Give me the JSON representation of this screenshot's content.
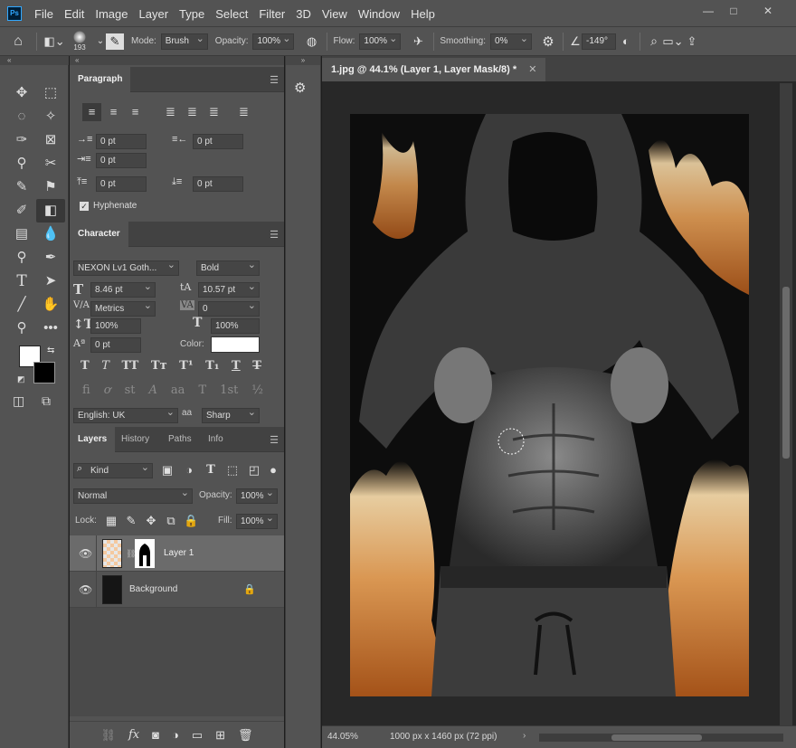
{
  "app": {
    "logo": "Ps",
    "menu": [
      "File",
      "Edit",
      "Image",
      "Layer",
      "Type",
      "Select",
      "Filter",
      "3D",
      "View",
      "Window",
      "Help"
    ],
    "window_buttons": [
      "—",
      "□",
      "✕"
    ]
  },
  "options": {
    "brush_size": "193",
    "mode_label": "Mode:",
    "mode_value": "Brush",
    "opacity_label": "Opacity:",
    "opacity_value": "100%",
    "flow_label": "Flow:",
    "flow_value": "100%",
    "smoothing_label": "Smoothing:",
    "smoothing_value": "0%",
    "angle_value": "-149°"
  },
  "paragraph": {
    "tab": "Paragraph",
    "indent_left": "0 pt",
    "indent_right": "0 pt",
    "indent_first": "0 pt",
    "space_before": "0 pt",
    "space_after": "0 pt",
    "hyphenate_label": "Hyphenate"
  },
  "character": {
    "tab": "Character",
    "font_family": "NEXON Lv1 Goth...",
    "font_style": "Bold",
    "font_size": "8.46 pt",
    "leading": "10.57 pt",
    "kerning": "Metrics",
    "tracking": "0",
    "vscale": "100%",
    "hscale": "100%",
    "baseline": "0 pt",
    "color_label": "Color:",
    "language": "English: UK",
    "aa_label": "aa",
    "antialias": "Sharp",
    "type_buttons": [
      "T",
      "T",
      "TT",
      "Tт",
      "T¹",
      "T₁",
      "T",
      "T"
    ],
    "opentype_buttons": [
      "fi",
      "ơ",
      "st",
      "A",
      "aa",
      "T",
      "1st",
      "½"
    ]
  },
  "layers": {
    "tabs": [
      "Layers",
      "History",
      "Paths",
      "Info"
    ],
    "filter_kind": "Kind",
    "blend_mode": "Normal",
    "opacity_label": "Opacity:",
    "opacity_value": "100%",
    "lock_label": "Lock:",
    "fill_label": "Fill:",
    "fill_value": "100%",
    "items": [
      {
        "name": "Layer 1"
      },
      {
        "name": "Background"
      }
    ],
    "footer_icons": [
      "link-icon",
      "fx-icon",
      "mask-icon",
      "adjustment-icon",
      "folder-icon",
      "new-layer-icon",
      "trash-icon"
    ]
  },
  "document": {
    "tab_title": "1.jpg @ 44.1% (Layer 1, Layer Mask/8) *",
    "zoom": "44.05%",
    "doc_info": "1000 px x 1460 px (72 ppi)"
  },
  "colors": {
    "foreground": "#ffffff",
    "background": "#000000",
    "char_color": "#ffffff"
  }
}
